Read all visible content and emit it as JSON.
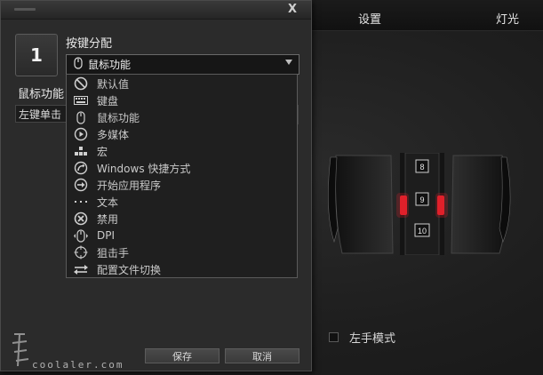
{
  "app": {
    "tabs": [
      {
        "label": "设置"
      },
      {
        "label": "灯光"
      }
    ],
    "left_hand_mode_label": "左手模式",
    "mouse_labels": [
      "8",
      "9",
      "10"
    ]
  },
  "dialog": {
    "close_label": "X",
    "key_number": "1",
    "assign_title": "按键分配",
    "selected_option": "鼠标功能",
    "function_title": "鼠标功能",
    "function_value": "左键单击",
    "options": [
      {
        "label": "默认值",
        "icon": "no-sign-icon"
      },
      {
        "label": "键盘",
        "icon": "keyboard-icon"
      },
      {
        "label": "鼠标功能",
        "icon": "mouse-icon"
      },
      {
        "label": "多媒体",
        "icon": "play-circle-icon"
      },
      {
        "label": "宏",
        "icon": "blocks-icon"
      },
      {
        "label": "Windows 快捷方式",
        "icon": "shortcut-icon"
      },
      {
        "label": "开始应用程序",
        "icon": "arrow-circle-icon"
      },
      {
        "label": "文本",
        "icon": "dots-icon"
      },
      {
        "label": "禁用",
        "icon": "x-circle-icon"
      },
      {
        "label": "DPI",
        "icon": "dpi-mouse-icon"
      },
      {
        "label": "狙击手",
        "icon": "crosshair-icon"
      },
      {
        "label": "配置文件切换",
        "icon": "swap-arrows-icon"
      }
    ],
    "save_label": "保存",
    "cancel_label": "取消"
  },
  "watermark": {
    "text": "coolaler.com"
  },
  "colors": {
    "accent_red": "#e0202a",
    "panel": "#2b2b2b"
  }
}
